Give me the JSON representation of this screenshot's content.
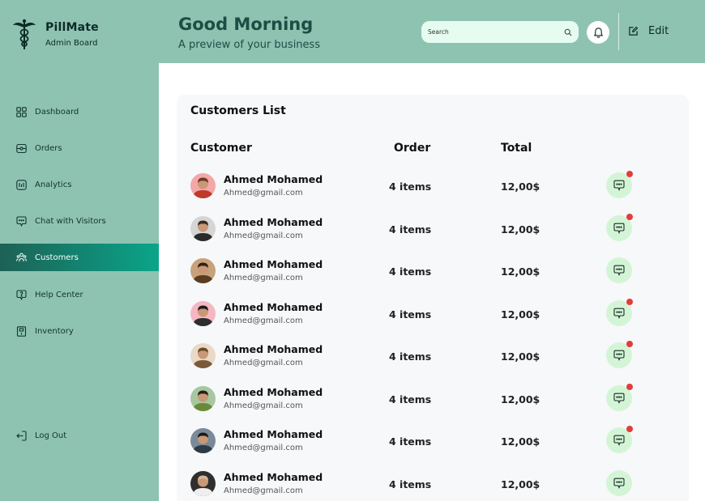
{
  "brand": {
    "name": "PillMate",
    "subtitle": "Admin Board"
  },
  "header": {
    "title": "Good Morning",
    "subtitle": "A preview of your business",
    "search_placeholder": "Search",
    "edit_label": "Edit"
  },
  "sidebar": {
    "items": [
      {
        "label": "Dashboard",
        "icon": "grid-icon",
        "active": false
      },
      {
        "label": "Orders",
        "icon": "wallet-icon",
        "active": false
      },
      {
        "label": "Analytics",
        "icon": "chart-icon",
        "active": false
      },
      {
        "label": "Chat with Visitors",
        "icon": "chat-icon",
        "active": false
      },
      {
        "label": "Customers",
        "icon": "users-icon",
        "active": true
      },
      {
        "label": "Help Center",
        "icon": "help-icon",
        "active": false
      },
      {
        "label": "Inventory",
        "icon": "inventory-icon",
        "active": false
      }
    ],
    "logout_label": "Log Out"
  },
  "customers": {
    "title": "Customers List",
    "columns": [
      "Customer",
      "Order",
      "Total"
    ],
    "rows": [
      {
        "name": "Ahmed Mohamed",
        "email": "Ahmed@gmail.com",
        "order": "4 items",
        "total": "12,00$",
        "unread": true
      },
      {
        "name": "Ahmed Mohamed",
        "email": "Ahmed@gmail.com",
        "order": "4 items",
        "total": "12,00$",
        "unread": true
      },
      {
        "name": "Ahmed Mohamed",
        "email": "Ahmed@gmail.com",
        "order": "4 items",
        "total": "12,00$",
        "unread": false
      },
      {
        "name": "Ahmed Mohamed",
        "email": "Ahmed@gmail.com",
        "order": "4 items",
        "total": "12,00$",
        "unread": true
      },
      {
        "name": "Ahmed Mohamed",
        "email": "Ahmed@gmail.com",
        "order": "4 items",
        "total": "12,00$",
        "unread": true
      },
      {
        "name": "Ahmed Mohamed",
        "email": "Ahmed@gmail.com",
        "order": "4 items",
        "total": "12,00$",
        "unread": true
      },
      {
        "name": "Ahmed Mohamed",
        "email": "Ahmed@gmail.com",
        "order": "4 items",
        "total": "12,00$",
        "unread": true
      },
      {
        "name": "Ahmed Mohamed",
        "email": "Ahmed@gmail.com",
        "order": "4 items",
        "total": "12,00$",
        "unread": false
      }
    ]
  },
  "colors": {
    "sidebar_bg": "#8ec3b2",
    "active_gradient_start": "#1d6155",
    "active_gradient_end": "#0aa58a",
    "chat_bg": "#d3f5d6",
    "notification_dot": "#e23c3c",
    "card_bg": "#f7f8fa"
  }
}
